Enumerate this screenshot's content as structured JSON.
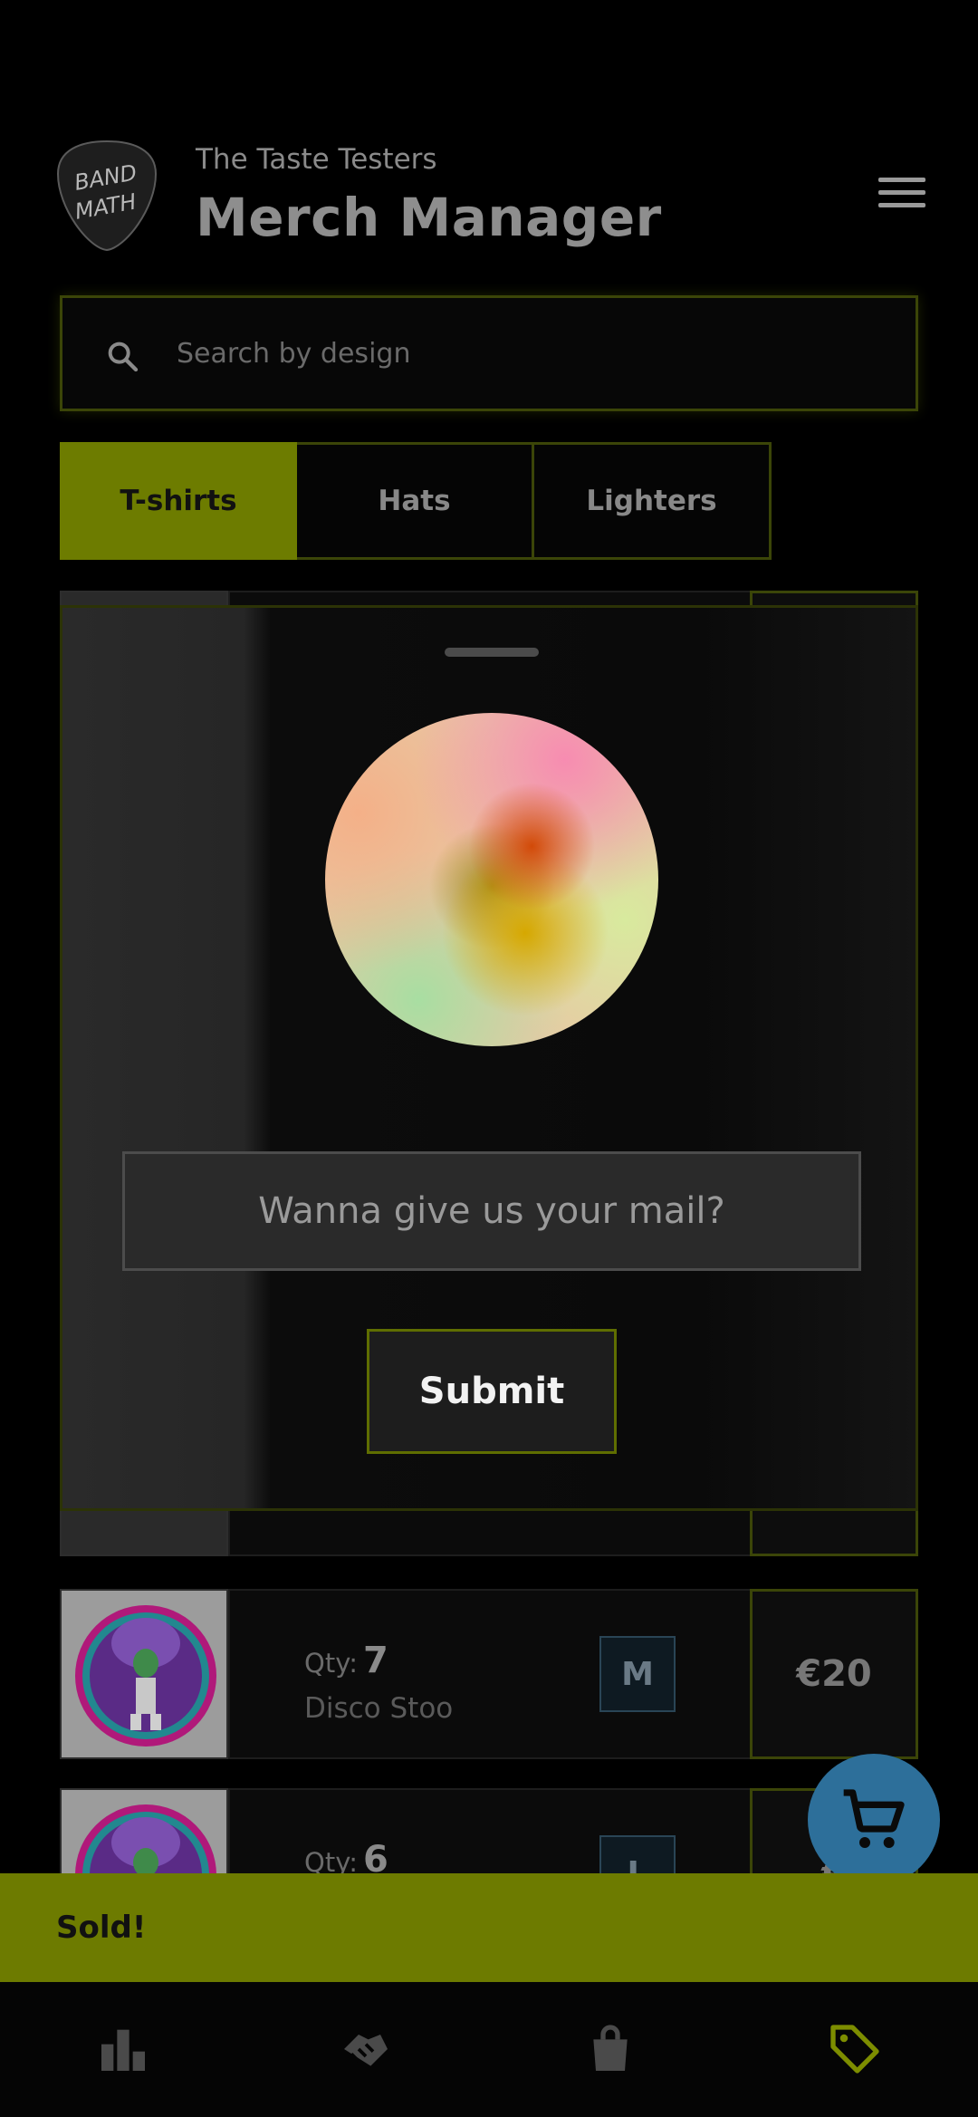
{
  "header": {
    "logo_text": "BAND MATH",
    "band_name": "The Taste Testers",
    "title": "Merch Manager",
    "menu_icon": "hamburger-menu-icon"
  },
  "search": {
    "placeholder": "Search by design",
    "icon": "search-icon"
  },
  "tabs": [
    {
      "label": "T-shirts",
      "active": true
    },
    {
      "label": "Hats",
      "active": false
    },
    {
      "label": "Lighters",
      "active": false
    }
  ],
  "items": [
    {
      "qty_label": "Qty:",
      "qty": "7",
      "name": "Disco Stoo",
      "size": "M",
      "price": "€20"
    },
    {
      "qty_label": "Qty:",
      "qty": "6",
      "size": "L",
      "price": "€"
    }
  ],
  "sheet": {
    "mail_placeholder": "Wanna give us your mail?",
    "submit_label": "Submit"
  },
  "fab": {
    "icon": "cart-icon"
  },
  "snackbar": {
    "text": "Sold!"
  },
  "nav": {
    "items": [
      {
        "icon": "bar-chart-icon"
      },
      {
        "icon": "handshake-icon"
      },
      {
        "icon": "shopping-bag-icon"
      },
      {
        "icon": "price-tag-icon",
        "active": true
      }
    ]
  },
  "colors": {
    "accent": "#6d7b00",
    "accent_border": "#3b4508",
    "fab": "#2d6f9a"
  }
}
